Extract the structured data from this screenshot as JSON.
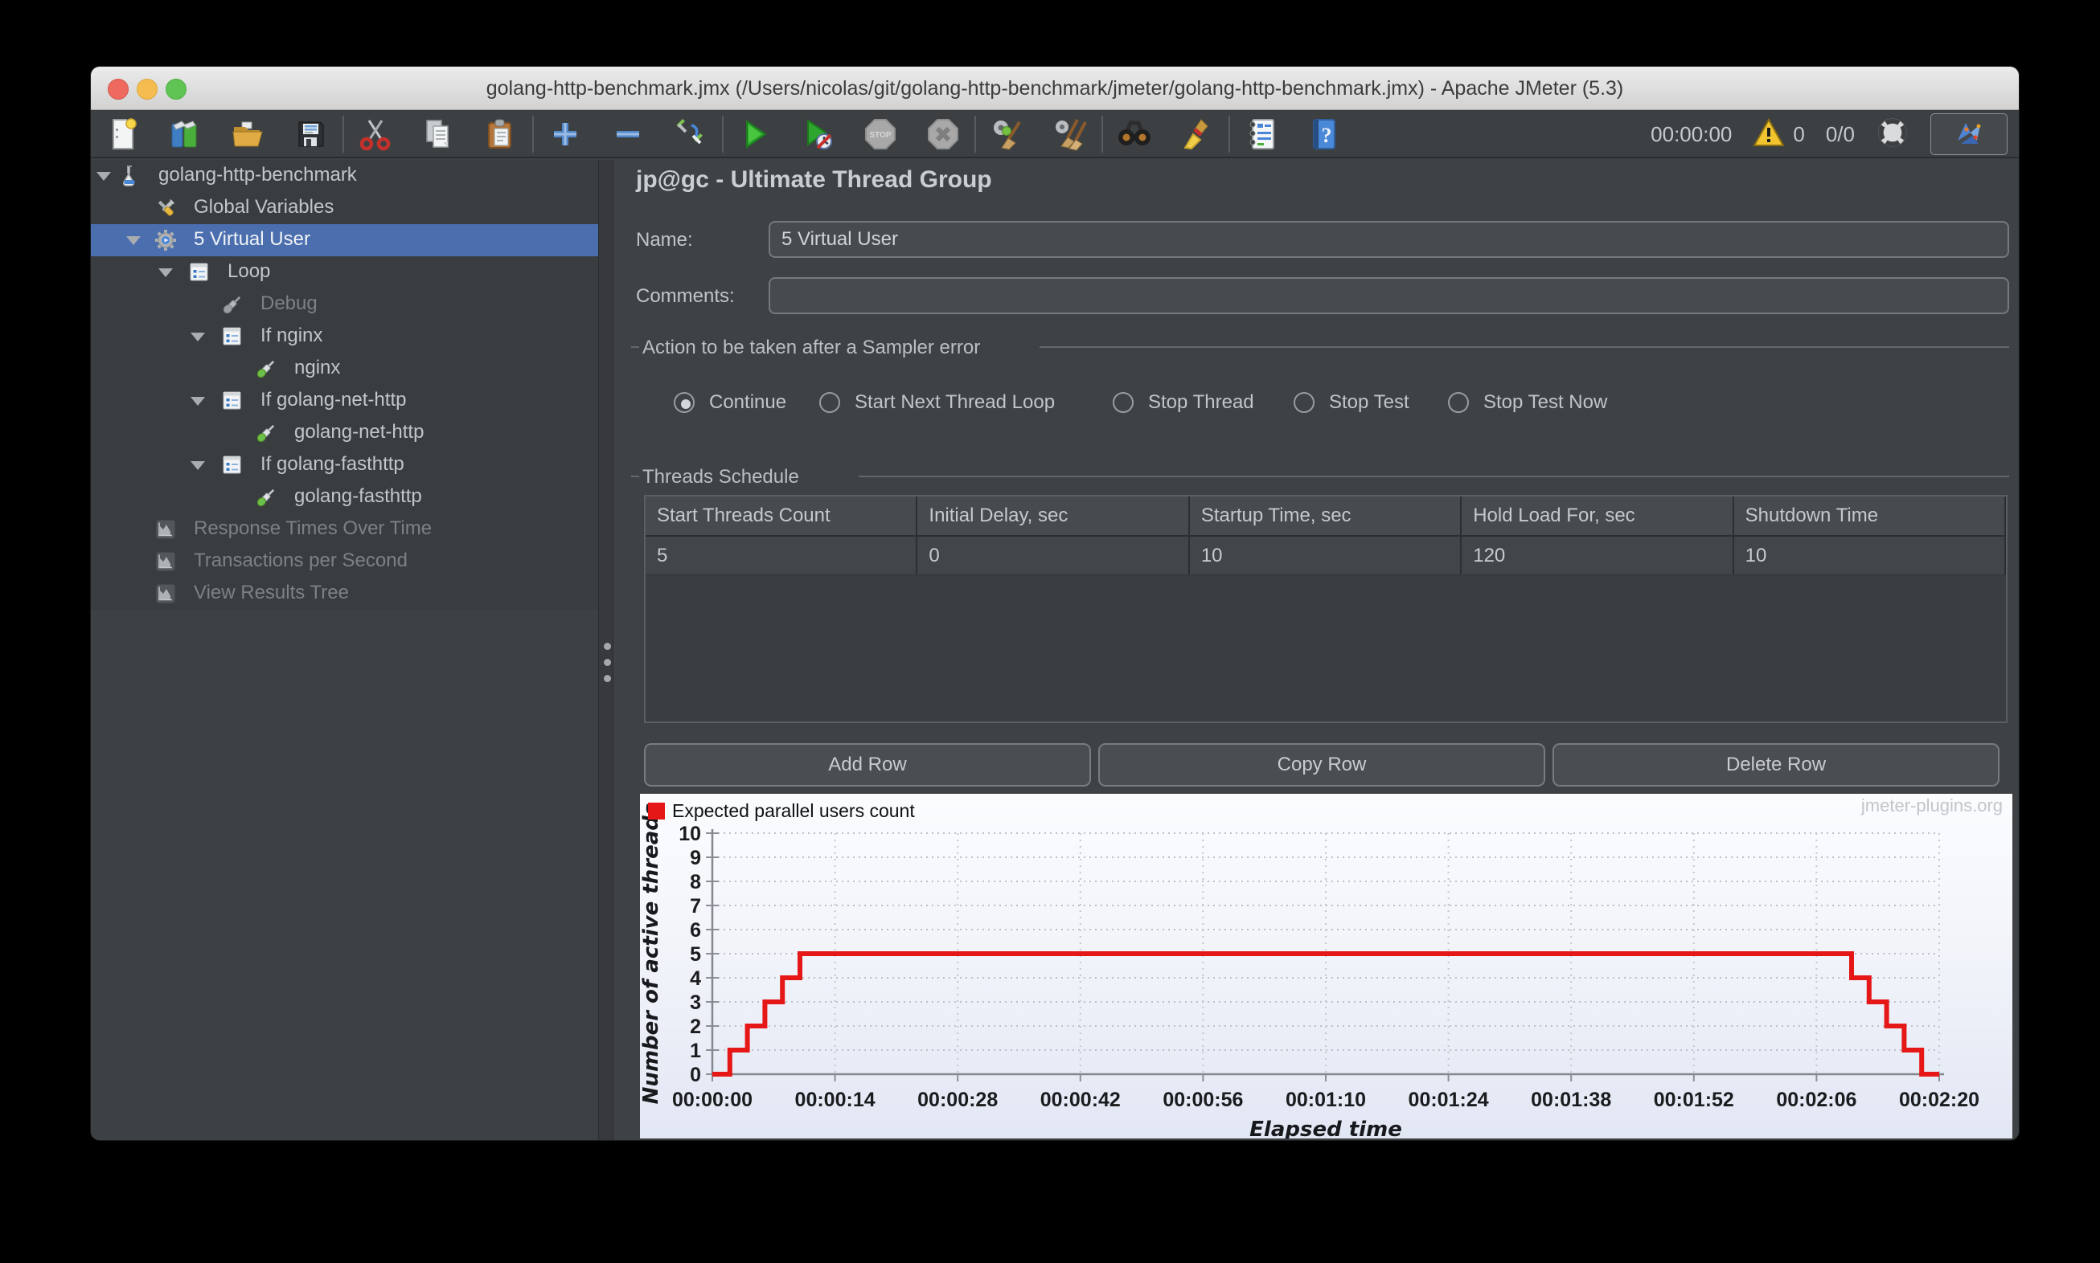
{
  "window": {
    "title": "golang-http-benchmark.jmx (/Users/nicolas/git/golang-http-benchmark/jmeter/golang-http-benchmark.jmx) - Apache JMeter (5.3)"
  },
  "toolbar": {
    "items": [
      "new-file",
      "templates",
      "open-file",
      "save",
      "|",
      "cut",
      "copy",
      "paste",
      "|",
      "add",
      "remove",
      "toggle",
      "|",
      "start",
      "start-no-timers",
      "stop",
      "shutdown",
      "|",
      "clear",
      "clear-all",
      "|",
      "search",
      "search-reset",
      "|",
      "function-helper",
      "help"
    ],
    "stop_glyph": "STOP",
    "timer": "00:00:00",
    "warning_count": "0",
    "thread_status": "0/0"
  },
  "tree": {
    "items": [
      {
        "label": "golang-http-benchmark",
        "icon": "test-plan-icon",
        "level": 0,
        "arrow": true,
        "state": "normal"
      },
      {
        "label": "Global Variables",
        "icon": "variables-icon",
        "level": 1,
        "arrow": false,
        "state": "normal"
      },
      {
        "label": "5 Virtual User",
        "icon": "thread-group-icon",
        "level": 1,
        "arrow": true,
        "state": "selected"
      },
      {
        "label": "Loop",
        "icon": "controller-icon",
        "level": 2,
        "arrow": true,
        "state": "normal"
      },
      {
        "label": "Debug",
        "icon": "sampler-disabled-icon",
        "level": 3,
        "arrow": false,
        "state": "disabled"
      },
      {
        "label": "If nginx",
        "icon": "controller-icon",
        "level": 3,
        "arrow": true,
        "state": "normal"
      },
      {
        "label": "nginx",
        "icon": "sampler-icon",
        "level": 4,
        "arrow": false,
        "state": "normal"
      },
      {
        "label": "If golang-net-http",
        "icon": "controller-icon",
        "level": 3,
        "arrow": true,
        "state": "normal"
      },
      {
        "label": "golang-net-http",
        "icon": "sampler-icon",
        "level": 4,
        "arrow": false,
        "state": "normal"
      },
      {
        "label": "If golang-fasthttp",
        "icon": "controller-icon",
        "level": 3,
        "arrow": true,
        "state": "normal"
      },
      {
        "label": "golang-fasthttp",
        "icon": "sampler-icon",
        "level": 4,
        "arrow": false,
        "state": "normal"
      },
      {
        "label": "Response Times Over Time",
        "icon": "listener-icon",
        "level": 1,
        "arrow": false,
        "state": "disabled"
      },
      {
        "label": "Transactions per Second",
        "icon": "listener-icon",
        "level": 1,
        "arrow": false,
        "state": "disabled"
      },
      {
        "label": "View Results Tree",
        "icon": "listener-icon",
        "level": 1,
        "arrow": false,
        "state": "disabled"
      }
    ]
  },
  "main": {
    "title": "jp@gc - Ultimate Thread Group",
    "name": {
      "label": "Name:",
      "value": "5 Virtual User"
    },
    "comments": {
      "label": "Comments:",
      "value": ""
    },
    "sampler_error": {
      "title": "Action to be taken after a Sampler error",
      "options": [
        {
          "label": "Continue",
          "selected": true
        },
        {
          "label": "Start Next Thread Loop",
          "selected": false
        },
        {
          "label": "Stop Thread",
          "selected": false
        },
        {
          "label": "Stop Test",
          "selected": false
        },
        {
          "label": "Stop Test Now",
          "selected": false
        }
      ]
    },
    "schedule": {
      "title": "Threads Schedule",
      "columns": [
        "Start Threads Count",
        "Initial Delay, sec",
        "Startup Time, sec",
        "Hold Load For, sec",
        "Shutdown Time"
      ],
      "rows": [
        [
          "5",
          "0",
          "10",
          "120",
          "10"
        ]
      ],
      "buttons": [
        "Add Row",
        "Copy Row",
        "Delete Row"
      ]
    }
  },
  "chart_data": {
    "type": "line",
    "subtype": "step",
    "legend": "Expected parallel users count",
    "legend_position": "top-left",
    "watermark": "jmeter-plugins.org",
    "xlabel": "Elapsed time",
    "ylabel": "Number of active threads",
    "xlim_sec": [
      0,
      140
    ],
    "ylim": [
      0,
      10
    ],
    "grid": true,
    "y_ticks": [
      0,
      1,
      2,
      3,
      4,
      5,
      6,
      7,
      8,
      9,
      10
    ],
    "x_ticks": [
      {
        "sec": 0,
        "label": "00:00:00"
      },
      {
        "sec": 14,
        "label": "00:00:14"
      },
      {
        "sec": 28,
        "label": "00:00:28"
      },
      {
        "sec": 42,
        "label": "00:00:42"
      },
      {
        "sec": 56,
        "label": "00:00:56"
      },
      {
        "sec": 70,
        "label": "00:01:10"
      },
      {
        "sec": 84,
        "label": "00:01:24"
      },
      {
        "sec": 98,
        "label": "00:01:38"
      },
      {
        "sec": 112,
        "label": "00:01:52"
      },
      {
        "sec": 126,
        "label": "00:02:06"
      },
      {
        "sec": 140,
        "label": "00:02:20"
      }
    ],
    "series": [
      {
        "name": "Expected parallel users count",
        "color": "#e51717",
        "points": [
          [
            0,
            0
          ],
          [
            2,
            0
          ],
          [
            2,
            1
          ],
          [
            4,
            1
          ],
          [
            4,
            2
          ],
          [
            6,
            2
          ],
          [
            6,
            3
          ],
          [
            8,
            3
          ],
          [
            8,
            4
          ],
          [
            10,
            4
          ],
          [
            10,
            5
          ],
          [
            130,
            5
          ],
          [
            130,
            4
          ],
          [
            132,
            4
          ],
          [
            132,
            3
          ],
          [
            134,
            3
          ],
          [
            134,
            2
          ],
          [
            136,
            2
          ],
          [
            136,
            1
          ],
          [
            138,
            1
          ],
          [
            138,
            0
          ],
          [
            140,
            0
          ]
        ]
      }
    ]
  }
}
